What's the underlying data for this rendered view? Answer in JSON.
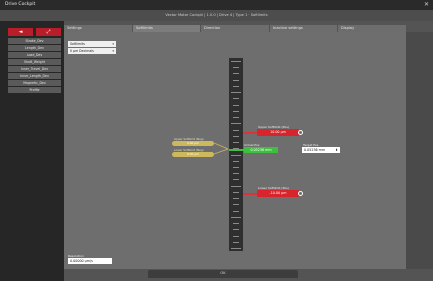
{
  "window": {
    "title": "Drive Cockpit",
    "close_glyph": "✕"
  },
  "header": {
    "title": "Vector Motor Cockpit | 1.0.0 | Drive 4 | Type 1 · Softlimits"
  },
  "sidebar": {
    "red_buttons": [
      "◄",
      "⤢"
    ],
    "items": [
      "Stroke_Dev",
      "Length_Dev",
      "Load_Dev",
      "Shaft_Weight",
      "Inner_Travel_Dev",
      "Inner_Length_Dev",
      "Magnetic_Dev",
      "Profile"
    ]
  },
  "tabs": [
    "Settings",
    "Softlimits",
    "Direction",
    "Inactive settings",
    "Display"
  ],
  "active_tab": 1,
  "controls": {
    "mode_select": "Softlimits",
    "unit_select": "0 μm Decimals"
  },
  "axis": {
    "ticks": 31
  },
  "limits": {
    "upper": {
      "label": "Upper Softlimit (Pos)",
      "value": "10.00 μm"
    },
    "lower": {
      "label": "Lower Softlimit (Pos)",
      "value": "-10.00 μm"
    }
  },
  "negative_limits": [
    {
      "label": "Upper Softlimit (Neg)",
      "value": "0.00 μm"
    },
    {
      "label": "Lower Softlimit (Neg)",
      "value": "0.00 μm"
    }
  ],
  "current": {
    "label": "Actual Pos",
    "value": "0.05236 mm",
    "target_label": "Target Pos",
    "target_value": "0.05236 mm"
  },
  "resolution": {
    "label": "Resolution",
    "value": "0.00000 μm/s"
  },
  "bottom": {
    "label": "OK"
  },
  "colors": {
    "limit": "#d8242c",
    "current": "#3fbf3f",
    "soft": "#cdb95b"
  },
  "icons": {
    "reset": "reset-icon"
  }
}
